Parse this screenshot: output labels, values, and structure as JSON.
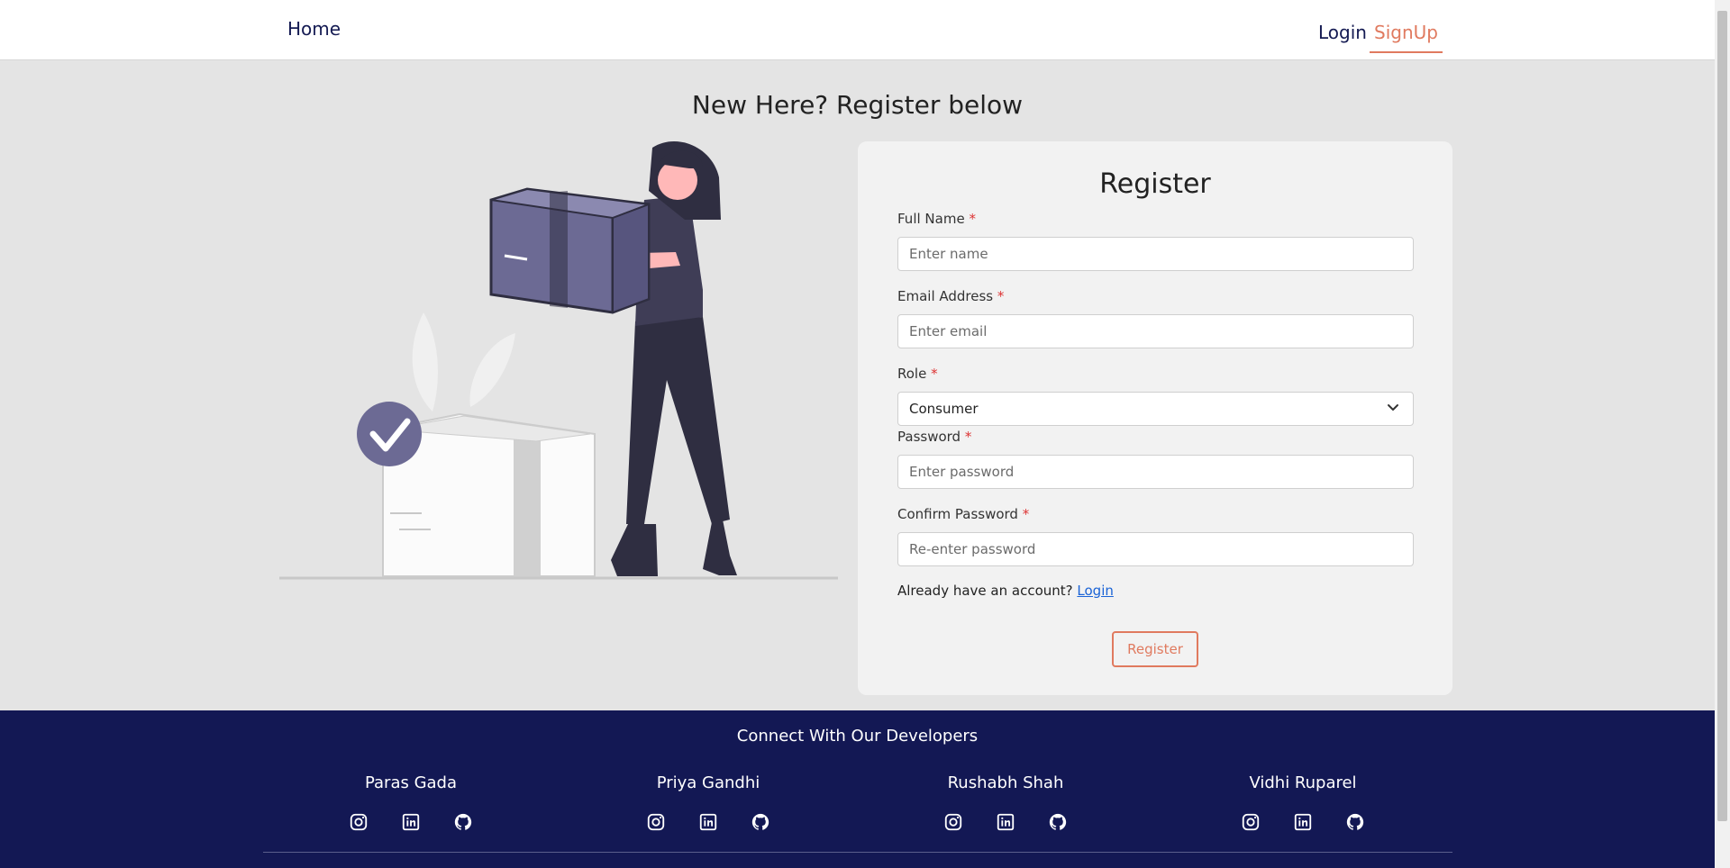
{
  "nav": {
    "home": "Home",
    "login": "Login",
    "signup": "SignUp"
  },
  "page": {
    "heading": "New Here? Register below"
  },
  "form": {
    "title": "Register",
    "fields": [
      {
        "label": "Full Name",
        "required": "*",
        "placeholder": "Enter name"
      },
      {
        "label": "Email Address",
        "required": "*",
        "placeholder": "Enter email"
      },
      {
        "label": "Role",
        "required": "*",
        "value": "Consumer"
      },
      {
        "label": "Password",
        "required": "*",
        "placeholder": "Enter password"
      },
      {
        "label": "Confirm Password",
        "required": "*",
        "placeholder": "Re-enter password"
      }
    ],
    "already_text": "Already have an account?",
    "login_link": "Login",
    "submit": "Register"
  },
  "footer": {
    "title": "Connect With Our Developers",
    "developers": [
      {
        "name": "Paras Gada",
        "icons": [
          "instagram-icon",
          "linkedin-icon",
          "github-icon"
        ]
      },
      {
        "name": "Priya Gandhi",
        "icons": [
          "instagram-icon",
          "linkedin-icon",
          "github-icon"
        ]
      },
      {
        "name": "Rushabh Shah",
        "icons": [
          "instagram-icon",
          "linkedin-icon",
          "github-icon"
        ]
      },
      {
        "name": "Vidhi Ruparel",
        "icons": [
          "instagram-icon",
          "linkedin-icon",
          "github-icon"
        ]
      }
    ]
  },
  "colors": {
    "accent": "#e07a5f",
    "navy": "#131854",
    "illustration_purple": "#6c6a94",
    "link": "#1a63d6"
  }
}
